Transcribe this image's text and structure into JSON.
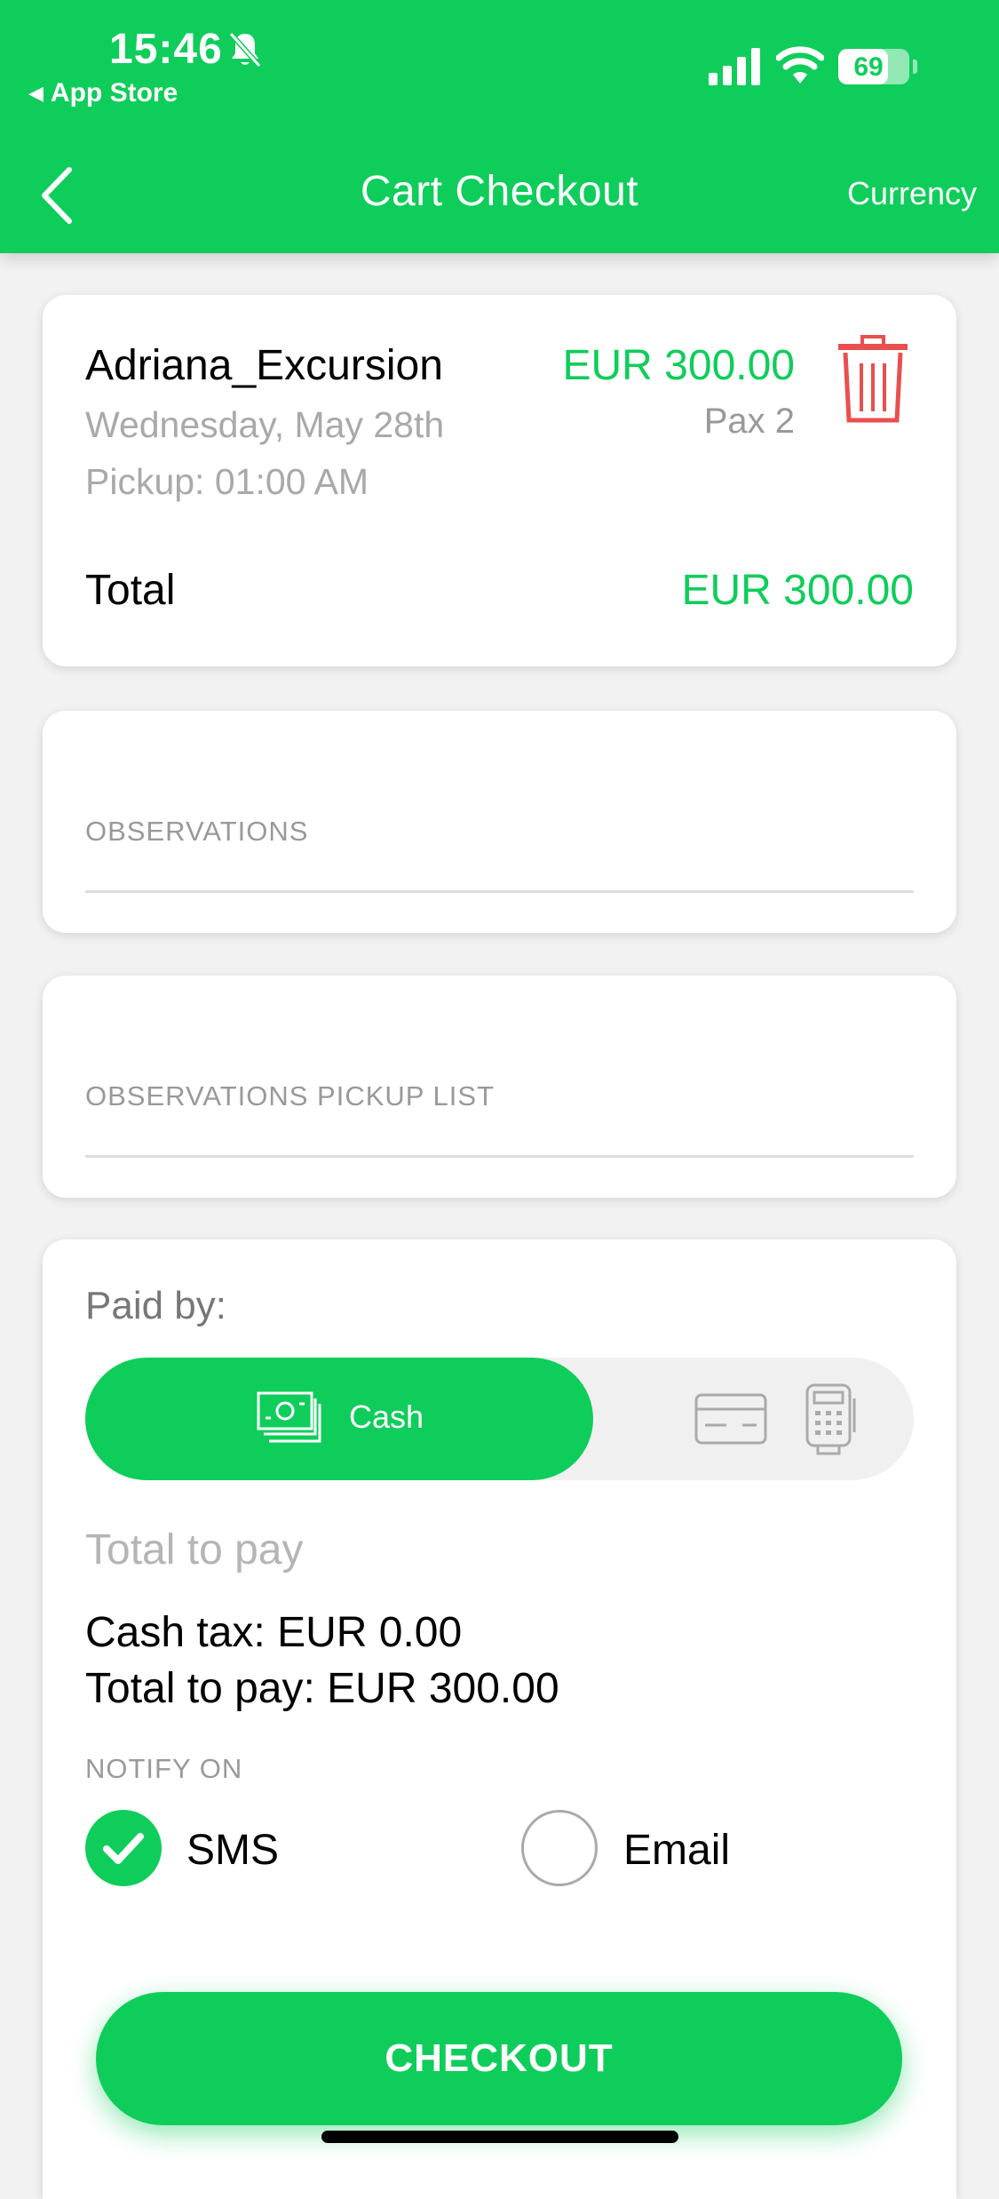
{
  "status_bar": {
    "time": "15:46",
    "back_app": "App Store",
    "battery": "69"
  },
  "nav": {
    "title": "Cart Checkout",
    "right_label": "Currency"
  },
  "cart_item": {
    "name": "Adriana_Excursion",
    "date": "Wednesday, May 28th",
    "pickup": "Pickup: 01:00 AM",
    "price": "EUR 300.00",
    "pax": "Pax 2",
    "total_label": "Total",
    "total_value": "EUR 300.00"
  },
  "fields": {
    "observations": "OBSERVATIONS",
    "observations_pickup": "OBSERVATIONS PICKUP LIST"
  },
  "payment": {
    "paid_by": "Paid by:",
    "cash_label": "Cash",
    "total_to_pay_heading": "Total to pay",
    "cash_tax": "Cash tax: EUR 0.00",
    "total_to_pay": "Total to pay: EUR 300.00",
    "notify_on": "NOTIFY ON",
    "sms": "SMS",
    "email": "Email",
    "sms_selected": true,
    "email_selected": false
  },
  "checkout_label": "CHECKOUT",
  "colors": {
    "accent": "#0fcd5b",
    "delete": "#e8504f"
  }
}
